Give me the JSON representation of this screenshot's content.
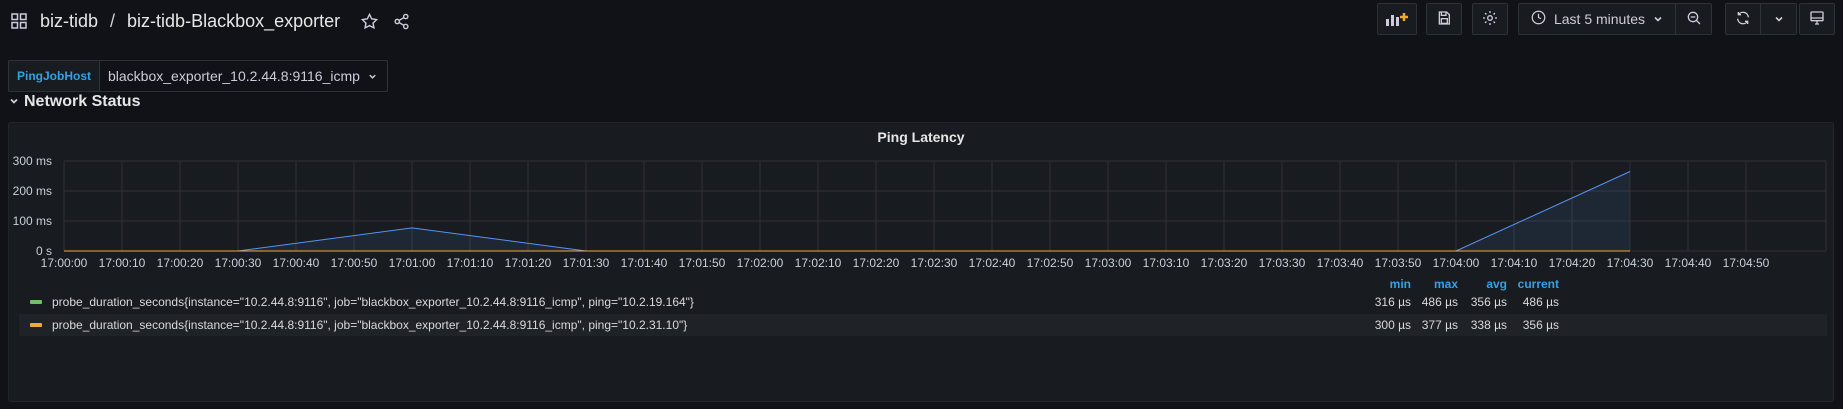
{
  "header": {
    "folder": "biz-tidb",
    "separator": "/",
    "dashboard": "biz-tidb-Blackbox_exporter",
    "time_range": "Last 5 minutes"
  },
  "variables": {
    "label": "PingJobHost",
    "value": "blackbox_exporter_10.2.44.8:9116_icmp"
  },
  "row": {
    "title": "Network Status"
  },
  "panel": {
    "title": "Ping Latency",
    "legend_headers": {
      "min": "min",
      "max": "max",
      "avg": "avg",
      "current": "current"
    },
    "legend": [
      {
        "name": "probe_duration_seconds{instance=\"10.2.44.8:9116\", job=\"blackbox_exporter_10.2.44.8:9116_icmp\", ping=\"10.2.19.164\"}",
        "min": "316 µs",
        "max": "486 µs",
        "avg": "356 µs",
        "current": "486 µs",
        "color": "#73bf69"
      },
      {
        "name": "probe_duration_seconds{instance=\"10.2.44.8:9116\", job=\"blackbox_exporter_10.2.44.8:9116_icmp\", ping=\"10.2.31.10\"}",
        "min": "300 µs",
        "max": "377 µs",
        "avg": "338 µs",
        "current": "356 µs",
        "color": "#f2a73d"
      }
    ]
  },
  "chart_data": {
    "type": "area",
    "y_ticks": [
      "300 ms",
      "200 ms",
      "100 ms",
      "0 s"
    ],
    "ylim": [
      0,
      300
    ],
    "x_ticks": [
      "17:00:00",
      "17:00:10",
      "17:00:20",
      "17:00:30",
      "17:00:40",
      "17:00:50",
      "17:01:00",
      "17:01:10",
      "17:01:20",
      "17:01:30",
      "17:01:40",
      "17:01:50",
      "17:02:00",
      "17:02:10",
      "17:02:20",
      "17:02:30",
      "17:02:40",
      "17:02:50",
      "17:03:00",
      "17:03:10",
      "17:03:20",
      "17:03:30",
      "17:03:40",
      "17:03:50",
      "17:04:00",
      "17:04:10",
      "17:04:20",
      "17:04:30",
      "17:04:40",
      "17:04:50"
    ],
    "grid": true,
    "series": [
      {
        "color": "#5794f2",
        "points": [
          [
            "17:00:00",
            0
          ],
          [
            "17:00:30",
            0
          ],
          [
            "17:01:00",
            77
          ],
          [
            "17:01:30",
            0
          ],
          [
            "17:04:00",
            0
          ],
          [
            "17:04:30",
            265
          ]
        ]
      },
      {
        "color": "#f2a73d",
        "points": [
          [
            "17:00:00",
            0
          ],
          [
            "17:04:30",
            0
          ]
        ]
      }
    ]
  }
}
